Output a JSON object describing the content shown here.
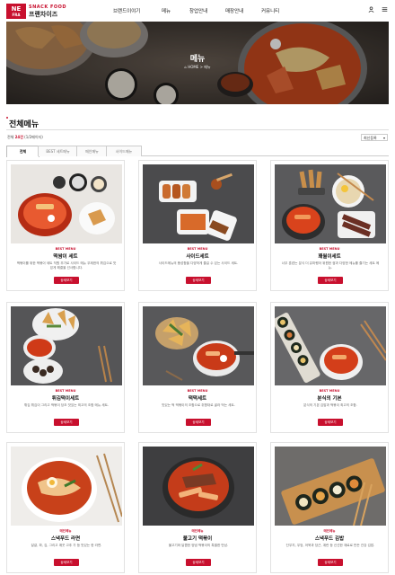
{
  "brand": {
    "logo_mark_top": "NE",
    "logo_mark_bottom": "FRA",
    "tagline": "SNACK FOOD",
    "name": "프랜차이즈",
    "accent": "#c8102e"
  },
  "nav": {
    "items": [
      "브랜드이야기",
      "메뉴",
      "창업안내",
      "매장안내",
      "커뮤니티"
    ],
    "icons": [
      "user-icon",
      "menu-icon"
    ]
  },
  "hero": {
    "title": "메뉴",
    "breadcrumb": "⌂ HOME  >  메뉴"
  },
  "section": {
    "title": "전체메뉴",
    "total_prefix": "전체 ",
    "total_count": "24건",
    "total_suffix": " (1/2페이지)",
    "sort_label": "최신등록"
  },
  "tabs": [
    "전체",
    "BEST 세트메뉴",
    "메인메뉴",
    "사이드메뉴"
  ],
  "cards": [
    {
      "badge": "BEST MENU",
      "name": "떡쌈이 세트",
      "desc": "떡볶이를 위한 떡볶이 세트 직원 추가로 사이드 메뉴 무제한의 튀김으로 맛있게 해결을 선사합니다.",
      "button": "상세보기"
    },
    {
      "badge": "BEST MENU",
      "name": "사이드세트",
      "desc": "사이드메뉴의 풍성함을 다양하게 즐길 수 있는 사이드 세트.",
      "button": "상세보기"
    },
    {
      "badge": "BEST MENU",
      "name": "꽤월이세트",
      "desc": "너무 훈련는 분식 더 유마행아 위원한 쌈과 다양한 메뉴를 즐기는 세트 메뉴.",
      "button": "상세보기"
    },
    {
      "badge": "BEST MENU",
      "name": "튀김떡이세트",
      "desc": "튀김 튀김이 그리고 떡볶이 당초 맛있는 최고의 조합 메뉴 세트.",
      "button": "상세보기"
    },
    {
      "badge": "BEST MENU",
      "name": "떡떡세트",
      "desc": "맛있는 떡 떡볶이의 조합으로 취향대로 골라 먹는 세트.",
      "button": "상세보기"
    },
    {
      "badge": "BEST MENU",
      "name": "분식의 기본",
      "desc": "분식의 기본 김밥과 떡볶이 최고의 조합.",
      "button": "상세보기"
    },
    {
      "badge": "메인메뉴",
      "name": "스낵푸드 라면",
      "desc": "달걀, 파, 김, 그리고 깨끗 고추 가 등 맛있는 한 라면.",
      "button": "상세보기"
    },
    {
      "badge": "메인메뉴",
      "name": "불고기 떡볶이",
      "desc": "불고기와 달콤한 양념 떡볶이의 특별한 만남.",
      "button": "상세보기"
    },
    {
      "badge": "메인메뉴",
      "name": "스낵푸드 김밥",
      "desc": "단무지, 우엉, 어묵과 당근, 계란 등 신선한 재료로 만든 건강 김밥.",
      "button": "상세보기"
    }
  ]
}
